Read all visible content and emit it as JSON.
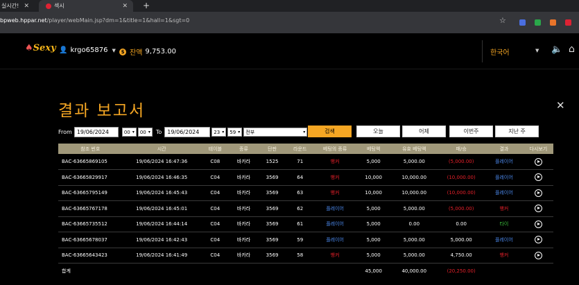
{
  "browser": {
    "tabs": [
      {
        "label": "실시간!"
      },
      {
        "label": "섹시"
      }
    ],
    "url_host": "bpweb.hppar.net",
    "url_path": "/player/webMain.jsp?dm=1&title=1&hall=1&sgt=0"
  },
  "header": {
    "logo": "Sexy",
    "username": "krgo65876",
    "balance_label": "잔액",
    "balance_value": "9,753.00",
    "language": "한국어"
  },
  "report": {
    "title": "결과 보고서",
    "from_label": "From",
    "from_date": "19/06/2024",
    "from_hour": "00",
    "from_min": "00",
    "to_label": "To",
    "to_date": "19/06/2024",
    "to_hour": "23",
    "to_min": "59",
    "type_select": "전부",
    "search_label": "검색",
    "btn_today": "오늘",
    "btn_yesterday": "어제",
    "btn_thisweek": "이번주",
    "btn_lastweek": "지난 주"
  },
  "table": {
    "headers": [
      "참조 번호",
      "시간",
      "테이블",
      "종류",
      "단판",
      "라운드",
      "베팅의 종류",
      "베팅액",
      "유효 베팅액",
      "패/승",
      "결과",
      "다시보기"
    ],
    "rows": [
      {
        "ref": "BAC-63665869105",
        "time": "19/06/2024 16:47:36",
        "table": "C08",
        "kind": "바카라",
        "shoe": "1525",
        "round": "71",
        "bet_type": "뱅커",
        "bet": "5,000",
        "valid": "5,000.00",
        "winloss": "(5,000.00)",
        "result": "플레이어"
      },
      {
        "ref": "BAC-63665829917",
        "time": "19/06/2024 16:46:35",
        "table": "C04",
        "kind": "바카라",
        "shoe": "3569",
        "round": "64",
        "bet_type": "뱅커",
        "bet": "10,000",
        "valid": "10,000.00",
        "winloss": "(10,000.00)",
        "result": "플레이어"
      },
      {
        "ref": "BAC-63665795149",
        "time": "19/06/2024 16:45:43",
        "table": "C04",
        "kind": "바카라",
        "shoe": "3569",
        "round": "63",
        "bet_type": "뱅커",
        "bet": "10,000",
        "valid": "10,000.00",
        "winloss": "(10,000.00)",
        "result": "플레이어"
      },
      {
        "ref": "BAC-63665767178",
        "time": "19/06/2024 16:45:01",
        "table": "C04",
        "kind": "바카라",
        "shoe": "3569",
        "round": "62",
        "bet_type": "플레이어",
        "bet": "5,000",
        "valid": "5,000.00",
        "winloss": "(5,000.00)",
        "result": "뱅커"
      },
      {
        "ref": "BAC-63665735512",
        "time": "19/06/2024 16:44:14",
        "table": "C04",
        "kind": "바카라",
        "shoe": "3569",
        "round": "61",
        "bet_type": "플레이어",
        "bet": "5,000",
        "valid": "0.00",
        "winloss": "0.00",
        "result": "타이"
      },
      {
        "ref": "BAC-63665678037",
        "time": "19/06/2024 16:42:43",
        "table": "C04",
        "kind": "바카라",
        "shoe": "3569",
        "round": "59",
        "bet_type": "플레이어",
        "bet": "5,000",
        "valid": "5,000.00",
        "winloss": "5,000.00",
        "result": "플레이어"
      },
      {
        "ref": "BAC-63665643423",
        "time": "19/06/2024 16:41:49",
        "table": "C04",
        "kind": "바카라",
        "shoe": "3569",
        "round": "58",
        "bet_type": "뱅커",
        "bet": "5,000",
        "valid": "5,000.00",
        "winloss": "4,750.00",
        "result": "뱅커"
      }
    ],
    "total": {
      "label": "합계",
      "bet": "45,000",
      "valid": "40,000.00",
      "winloss": "(20,250.00)"
    }
  },
  "colors": {
    "accent": "#f5a623",
    "banker": "#e8202a",
    "player": "#4a86e8",
    "tie": "#3bbf3b"
  }
}
